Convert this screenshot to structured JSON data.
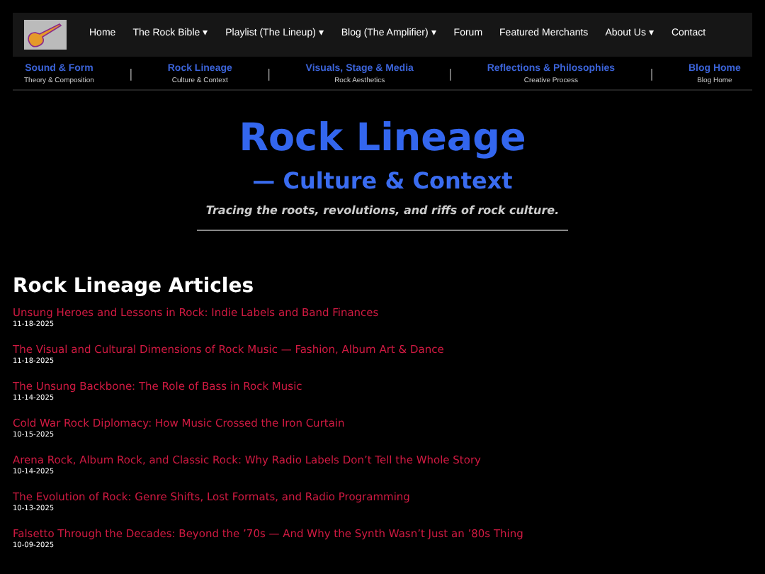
{
  "nav": {
    "items": [
      {
        "label": "Home",
        "caret": false
      },
      {
        "label": "The Rock Bible",
        "caret": true
      },
      {
        "label": "Playlist (The Lineup)",
        "caret": true
      },
      {
        "label": "Blog (The Amplifier)",
        "caret": true
      },
      {
        "label": "Forum",
        "caret": false
      },
      {
        "label": "Featured Merchants",
        "caret": false
      },
      {
        "label": "About Us",
        "caret": true
      },
      {
        "label": "Contact",
        "caret": false
      }
    ],
    "caret_glyph": "▾"
  },
  "subnav": [
    {
      "label": "Sound & Form",
      "sub": "Theory & Composition"
    },
    {
      "label": "Rock Lineage",
      "sub": "Culture & Context"
    },
    {
      "label": "Visuals, Stage & Media",
      "sub": "Rock Aesthetics"
    },
    {
      "label": "Reflections & Philosophies",
      "sub": "Creative Process"
    },
    {
      "label": "Blog Home",
      "sub": "Blog Home"
    }
  ],
  "separator": "|",
  "hero": {
    "title": "Rock Lineage",
    "subtitle": "— Culture & Context",
    "tagline": "Tracing the roots, revolutions, and riffs of rock culture."
  },
  "articles": {
    "heading": "Rock Lineage Articles",
    "items": [
      {
        "title": "Unsung Heroes and Lessons in Rock: Indie Labels and Band Finances",
        "date": "11-18-2025"
      },
      {
        "title": "The Visual and Cultural Dimensions of Rock Music — Fashion, Album Art & Dance",
        "date": "11-18-2025"
      },
      {
        "title": "The Unsung Backbone: The Role of Bass in Rock Music",
        "date": "11-14-2025"
      },
      {
        "title": "Cold War Rock Diplomacy: How Music Crossed the Iron Curtain",
        "date": "10-15-2025"
      },
      {
        "title": "Arena Rock, Album Rock, and Classic Rock: Why Radio Labels Don’t Tell the Whole Story",
        "date": "10-14-2025"
      },
      {
        "title": "The Evolution of Rock: Genre Shifts, Lost Formats, and Radio Programming",
        "date": "10-13-2025"
      },
      {
        "title": "Falsetto Through the Decades: Beyond the ’70s — And Why the Synth Wasn’t Just an ’80s Thing",
        "date": "10-09-2025"
      }
    ]
  }
}
